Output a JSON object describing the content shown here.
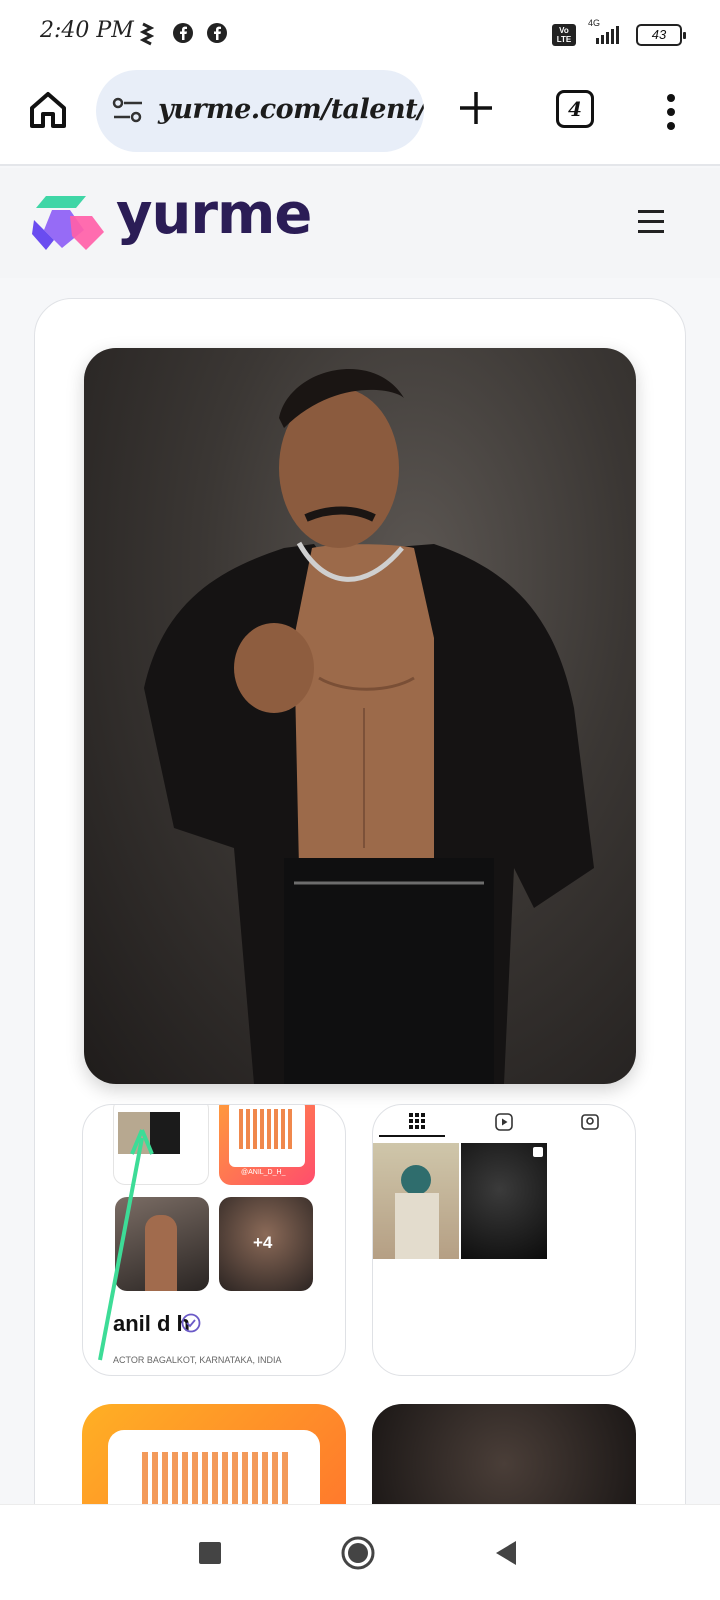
{
  "status_bar": {
    "time": "2:40 PM",
    "battery": "43",
    "network_label": "4G",
    "volte_label": "Vo LTE"
  },
  "browser": {
    "url": "yurme.com/talent/an",
    "tab_count": "4"
  },
  "site": {
    "brand": "yurme"
  },
  "profile": {
    "name": "anil d h",
    "qr_handle": "@ANIL_D_H_",
    "more_photos": "+4",
    "meta_line": "ACTOR   BAGALKOT, KARNATAKA, INDIA"
  },
  "colors": {
    "brand_dark": "#2b1d56",
    "annotation_arrow": "#3ddc97",
    "url_pill": "#e8eef8"
  },
  "icons": [
    "home-icon",
    "tune-icon",
    "plus-icon",
    "tabs-icon",
    "more-vert-icon",
    "menu-icon",
    "grid-icon",
    "reels-icon",
    "tagged-icon",
    "verified-icon",
    "square-nav-icon",
    "circle-nav-icon",
    "back-nav-icon"
  ]
}
